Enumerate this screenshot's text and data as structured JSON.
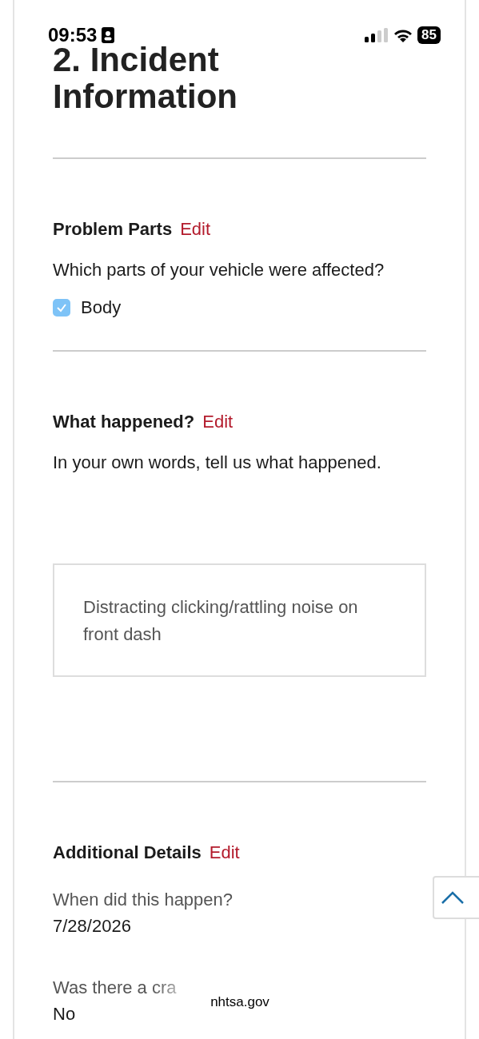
{
  "status_bar": {
    "time": "09:53",
    "battery": "85"
  },
  "heading": "2. Incident Information",
  "sections": [
    {
      "title": "Problem Parts",
      "edit": "Edit",
      "question": "Which parts of your vehicle were affected?",
      "kind": "checkboxes",
      "options": [
        {
          "label": "Body",
          "checked": true
        }
      ]
    },
    {
      "title": "What happened?",
      "edit": "Edit",
      "question": "In your own words, tell us what happened.",
      "kind": "textarea",
      "value": "Distracting clicking/rattling noise on front dash"
    },
    {
      "title": "Additional Details",
      "edit": "Edit",
      "kind": "details",
      "items": [
        {
          "question": "When did this happen?",
          "answer": "7/28/2026"
        },
        {
          "question": "Was there a cra",
          "answer": "No"
        }
      ]
    }
  ],
  "url_pill": "nhtsa.gov"
}
